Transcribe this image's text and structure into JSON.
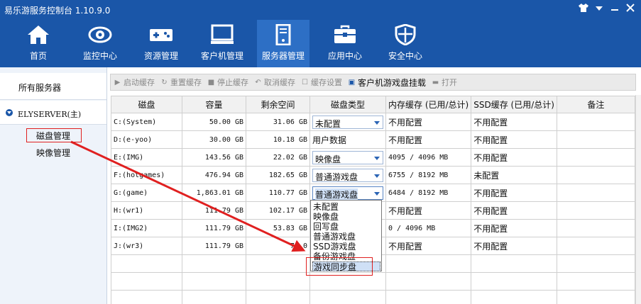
{
  "app": {
    "title": "易乐游服务控制台 1.10.9.0"
  },
  "window_icons": [
    "tshirt-icon",
    "chevron-down-icon",
    "minimize-icon",
    "close-icon"
  ],
  "nav": {
    "items": [
      {
        "label": "首页",
        "icon": "home-icon"
      },
      {
        "label": "监控中心",
        "icon": "eye-icon"
      },
      {
        "label": "资源管理",
        "icon": "gamepad-icon"
      },
      {
        "label": "客户机管理",
        "icon": "monitor-icon"
      },
      {
        "label": "服务器管理",
        "icon": "server-icon",
        "active": true
      },
      {
        "label": "应用中心",
        "icon": "toolbox-icon"
      },
      {
        "label": "安全中心",
        "icon": "shield-icon"
      }
    ]
  },
  "sidebar": {
    "all_servers": "所有服务器",
    "server_name": "ELYSERVER(主)",
    "sub_items": [
      "磁盘管理",
      "映像管理"
    ]
  },
  "toolbar": {
    "buttons": [
      {
        "label": "启动缓存",
        "enabled": false
      },
      {
        "label": "重置缓存",
        "enabled": false
      },
      {
        "label": "停止缓存",
        "enabled": false
      },
      {
        "label": "取消缓存",
        "enabled": false
      },
      {
        "label": "缓存设置",
        "enabled": false
      },
      {
        "label": "客户机游戏盘挂载",
        "enabled": true
      },
      {
        "label": "打开",
        "enabled": false
      }
    ]
  },
  "table": {
    "headers": [
      "磁盘",
      "容量",
      "剩余空间",
      "磁盘类型",
      "内存缓存 (已用/总计)",
      "SSD缓存 (已用/总计)",
      "备注"
    ],
    "rows": [
      {
        "disk": "C:(System)",
        "capacity": "50.00 GB",
        "free": "31.06 GB",
        "type": "未配置",
        "type_select": true,
        "mem": "不用配置",
        "ssd": "不用配置",
        "note": ""
      },
      {
        "disk": "D:(e-yoo)",
        "capacity": "30.00 GB",
        "free": "10.18 GB",
        "type": "用户数据",
        "type_select": false,
        "mem": "不用配置",
        "ssd": "不用配置",
        "note": ""
      },
      {
        "disk": "E:(IMG)",
        "capacity": "143.56 GB",
        "free": "22.02 GB",
        "type": "映像盘",
        "type_select": true,
        "mem": "4095 / 4096 MB",
        "ssd": "不用配置",
        "note": ""
      },
      {
        "disk": "F:(hotgames)",
        "capacity": "476.94 GB",
        "free": "182.65 GB",
        "type": "普通游戏盘",
        "type_select": true,
        "mem": "6755 / 8192 MB",
        "ssd": "未配置",
        "note": ""
      },
      {
        "disk": "G:(game)",
        "capacity": "1,863.01 GB",
        "free": "110.77 GB",
        "type": "普通游戏盘",
        "type_select": true,
        "type_active": true,
        "mem": "6484 / 8192 MB",
        "ssd": "不用配置",
        "note": ""
      },
      {
        "disk": "H:(wr1)",
        "capacity": "111.79 GB",
        "free": "102.17 GB",
        "type": "",
        "type_select": false,
        "mem": "不用配置",
        "ssd": "不用配置",
        "note": ""
      },
      {
        "disk": "I:(IMG2)",
        "capacity": "111.79 GB",
        "free": "53.83 GB",
        "type": "",
        "type_select": false,
        "mem": "0 / 4096 MB",
        "ssd": "不用配置",
        "note": ""
      },
      {
        "disk": "J:(wr3)",
        "capacity": "111.79 GB",
        "free": "79.0",
        "type": "",
        "type_select": false,
        "mem": "不用配置",
        "ssd": "不用配置",
        "note": ""
      }
    ],
    "empty_rows": 3
  },
  "dropdown": {
    "options": [
      "未配置",
      "映像盘",
      "回写盘",
      "普通游戏盘",
      "SSD游戏盘",
      "备份游戏盘",
      "游戏同步盘"
    ],
    "highlighted": "游戏同步盘"
  },
  "annotation": {
    "color": "#e02020"
  }
}
